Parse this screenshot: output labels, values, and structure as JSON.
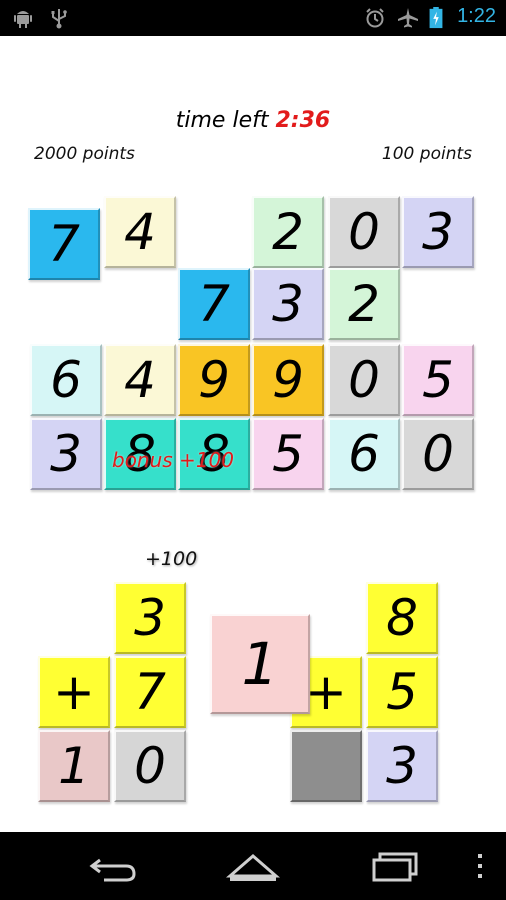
{
  "status_bar": {
    "clock": "1:22",
    "left_icons": [
      "android-icon",
      "usb-icon"
    ],
    "right_icons": [
      "alarm-icon",
      "airplane-mode-icon",
      "battery-charging-icon"
    ],
    "clock_color": "#33b5e5"
  },
  "header": {
    "time_label": "time left",
    "time_value": "2:36",
    "time_value_color": "#e21b1b",
    "left_score": "2000 points",
    "right_score": "100 points"
  },
  "board": {
    "colors": {
      "blue": "#2ab8ee",
      "lemon": "#fbf8d6",
      "green": "#d4f5d8",
      "gray": "#d8d8d8",
      "lavender": "#d4d4f4",
      "cyan": "#d6f6f6",
      "orange": "#f9c524",
      "pink": "#f8d4ee",
      "teal": "#36e0cb"
    },
    "tiles": [
      {
        "id": "r1c1",
        "digit": "7",
        "color": "blue"
      },
      {
        "id": "r1c2",
        "digit": "4",
        "color": "lemon"
      },
      {
        "id": "r1c4",
        "digit": "2",
        "color": "green"
      },
      {
        "id": "r1c5",
        "digit": "0",
        "color": "gray"
      },
      {
        "id": "r1c6",
        "digit": "3",
        "color": "lavender"
      },
      {
        "id": "r2c3",
        "digit": "7",
        "color": "blue"
      },
      {
        "id": "r2c4",
        "digit": "3",
        "color": "lavender"
      },
      {
        "id": "r2c5",
        "digit": "2",
        "color": "green"
      },
      {
        "id": "r3c1",
        "digit": "6",
        "color": "cyan"
      },
      {
        "id": "r3c2",
        "digit": "4",
        "color": "lemon"
      },
      {
        "id": "r3c3",
        "digit": "9",
        "color": "orange"
      },
      {
        "id": "r3c4",
        "digit": "9",
        "color": "orange"
      },
      {
        "id": "r3c5",
        "digit": "0",
        "color": "gray"
      },
      {
        "id": "r3c6",
        "digit": "5",
        "color": "pink"
      },
      {
        "id": "r4c1",
        "digit": "3",
        "color": "lavender"
      },
      {
        "id": "r4c2",
        "digit": "8",
        "color": "teal"
      },
      {
        "id": "r4c3",
        "digit": "8",
        "color": "teal"
      },
      {
        "id": "r4c4",
        "digit": "5",
        "color": "pink"
      },
      {
        "id": "r4c5",
        "digit": "6",
        "color": "cyan"
      },
      {
        "id": "r4c6",
        "digit": "0",
        "color": "gray"
      }
    ],
    "bonus_label": "bonus +100",
    "bonus_color": "#e21b1b"
  },
  "equations": {
    "colors": {
      "yellow": "#ffff33",
      "rose": "#e9c8c8",
      "gray": "#d6d6d6",
      "lavender": "#d4d4f4",
      "current": "#f9d2d2",
      "empty": "#8e8e8e"
    },
    "points_label": "+100",
    "left": [
      {
        "id": "eqL-top",
        "text": "3",
        "color": "yellow"
      },
      {
        "id": "eqL-op",
        "text": "+",
        "color": "yellow"
      },
      {
        "id": "eqL-mid",
        "text": "7",
        "color": "yellow"
      },
      {
        "id": "eqL-ans1",
        "text": "1",
        "color": "rose"
      },
      {
        "id": "eqL-ans2",
        "text": "0",
        "color": "gray"
      }
    ],
    "right": [
      {
        "id": "eqR-top",
        "text": "8",
        "color": "yellow"
      },
      {
        "id": "eqR-op",
        "text": "+",
        "color": "yellow"
      },
      {
        "id": "eqR-mid",
        "text": "5",
        "color": "yellow"
      },
      {
        "id": "eqR-ans1",
        "text": "",
        "color": "empty"
      },
      {
        "id": "eqR-ans2",
        "text": "3",
        "color": "lavender"
      }
    ],
    "current_tile": {
      "text": "1",
      "color": "current"
    }
  },
  "nav_bar": {
    "icons": [
      "back-icon",
      "home-icon",
      "recent-apps-icon",
      "overflow-menu-icon"
    ]
  }
}
